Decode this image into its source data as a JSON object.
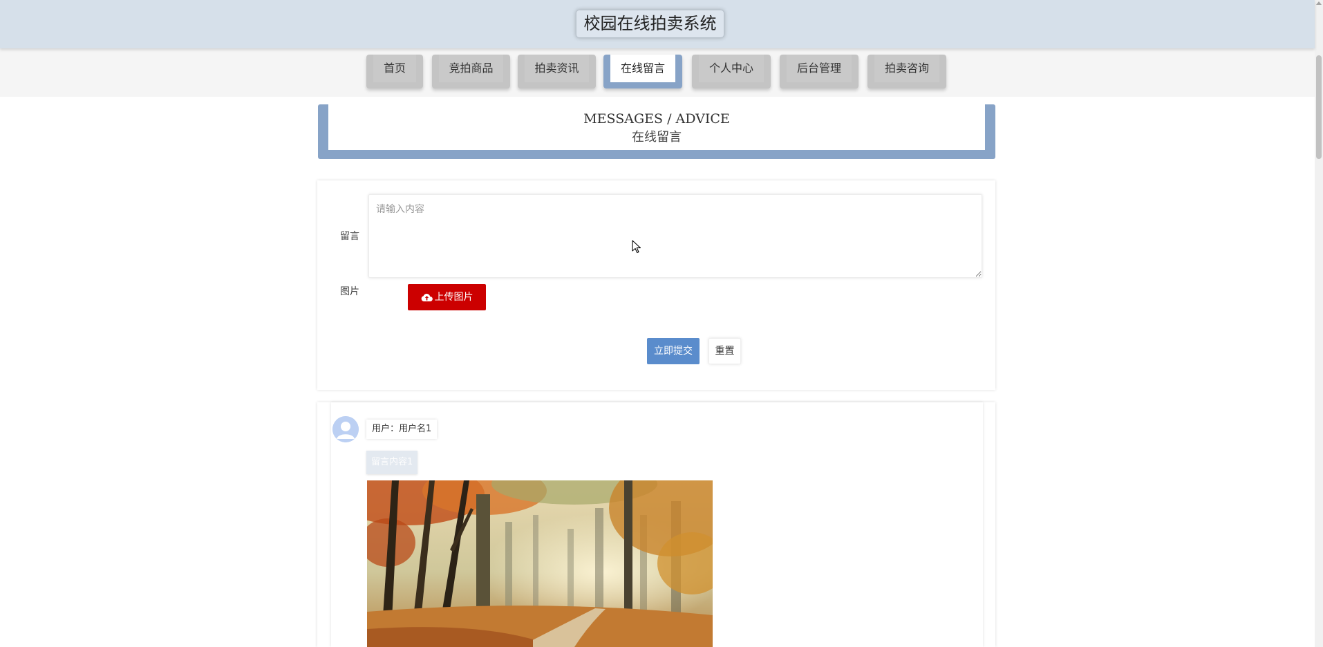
{
  "header": {
    "title": "校园在线拍卖系统"
  },
  "nav": {
    "items": [
      {
        "label": "首页",
        "active": false
      },
      {
        "label": "竞拍商品",
        "active": false
      },
      {
        "label": "拍卖资讯",
        "active": false
      },
      {
        "label": "在线留言",
        "active": true
      },
      {
        "label": "个人中心",
        "active": false
      },
      {
        "label": "后台管理",
        "active": false
      },
      {
        "label": "拍卖咨询",
        "active": false
      }
    ]
  },
  "section": {
    "title_en": "MESSAGES / ADVICE",
    "title_zh": "在线留言"
  },
  "form": {
    "message_label": "留言",
    "message_placeholder": "请输入内容",
    "message_value": "",
    "image_label": "图片",
    "upload_label": "上传图片",
    "submit_label": "立即提交",
    "reset_label": "重置"
  },
  "messages": [
    {
      "user": "用户：用户名1",
      "content": "留言内容1",
      "image": "autumn-forest-photo"
    }
  ],
  "colors": {
    "header_bg": "#d6e0ea",
    "accent_blue": "#87a3c7",
    "submit_blue": "#5a8ccc",
    "upload_red": "#cc0000"
  }
}
